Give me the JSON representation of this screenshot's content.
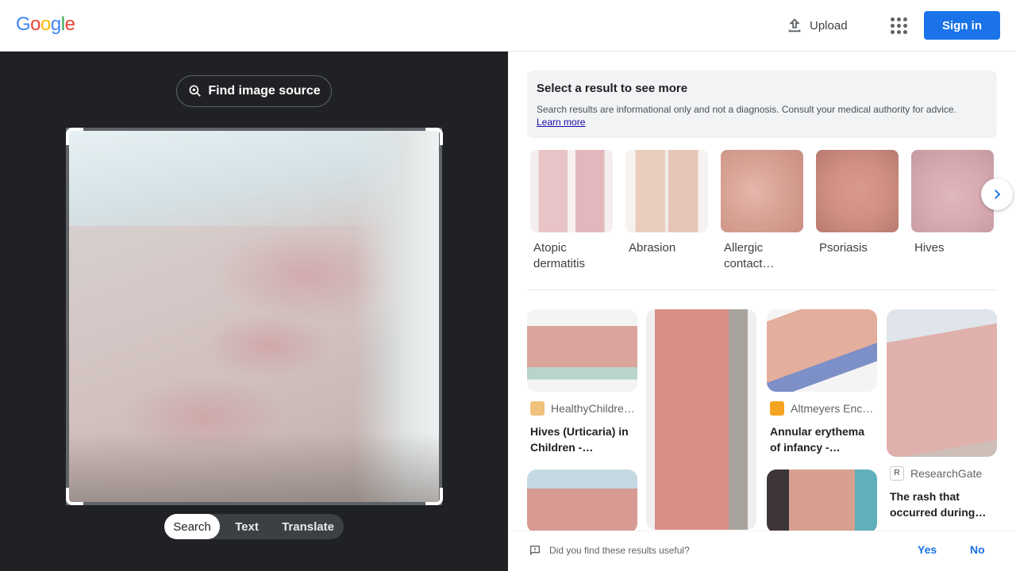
{
  "header": {
    "logo_letters": [
      {
        "ch": "G",
        "color": "#4285F4"
      },
      {
        "ch": "o",
        "color": "#EA4335"
      },
      {
        "ch": "o",
        "color": "#FBBC05"
      },
      {
        "ch": "g",
        "color": "#4285F4"
      },
      {
        "ch": "l",
        "color": "#34A853"
      },
      {
        "ch": "e",
        "color": "#EA4335"
      }
    ],
    "upload_label": "Upload",
    "signin_label": "Sign in",
    "apps_icon": "apps-grid-icon",
    "upload_icon": "upload-icon"
  },
  "left": {
    "find_source_label": "Find image source",
    "modes": [
      {
        "label": "Search",
        "active": true
      },
      {
        "label": "Text",
        "active": false
      },
      {
        "label": "Translate",
        "active": false
      }
    ]
  },
  "notice": {
    "title": "Select a result to see more",
    "body": "Search results are informational only and not a diagnosis. Consult your medical authority for advice.",
    "link": "Learn more"
  },
  "conditions": [
    {
      "label": "Atopic dermatitis",
      "color": "#e4c2c4"
    },
    {
      "label": "Abrasion",
      "color": "#e7c8bd"
    },
    {
      "label": "Allergic contact…",
      "color": "#d9aa9d"
    },
    {
      "label": "Psoriasis",
      "color": "#cf9a8e"
    },
    {
      "label": "Hives",
      "color": "#d9b3b8"
    }
  ],
  "results": [
    {
      "source": "HealthyChildre…",
      "title": "Hives (Urticaria) in Children -…"
    },
    {
      "source": "Altmeyers Enc…",
      "title": "Annular erythema of infancy -…"
    },
    {
      "source": "ResearchGate",
      "title": "The rash that occurred during…"
    }
  ],
  "feedback": {
    "question": "Did you find these results useful?",
    "yes": "Yes",
    "no": "No"
  }
}
